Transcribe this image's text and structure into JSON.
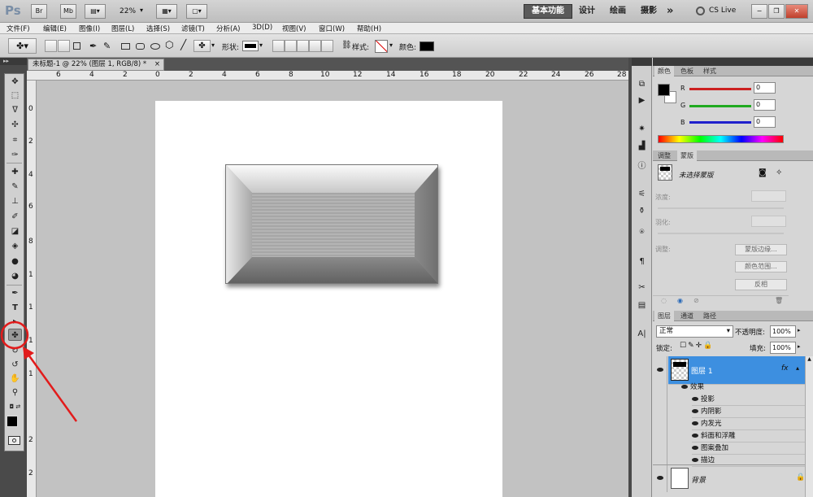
{
  "titlebar": {
    "ps_logo": "Ps",
    "br_btn": "Br",
    "mb_btn": "Mb",
    "zoom": "22%",
    "workspaces": [
      "基本功能",
      "设计",
      "绘画",
      "摄影"
    ],
    "more": "»",
    "cs_live": "CS Live"
  },
  "menu": [
    "文件(F)",
    "编辑(E)",
    "图像(I)",
    "图层(L)",
    "选择(S)",
    "滤镜(T)",
    "分析(A)",
    "3D(D)",
    "视图(V)",
    "窗口(W)",
    "帮助(H)"
  ],
  "options": {
    "shape_label": "形状:",
    "style_label": "样式:",
    "color_label": "颜色:",
    "color_value": "#000000"
  },
  "document": {
    "tab_title": "未标题-1 @ 22% (图层 1, RGB/8) *",
    "close": "×"
  },
  "rulers": {
    "top": [
      "6",
      "4",
      "2",
      "0",
      "2",
      "4",
      "6",
      "8",
      "10",
      "12",
      "14",
      "16",
      "18",
      "20",
      "22",
      "24",
      "26",
      "28"
    ],
    "left": [
      "0",
      "2",
      "4",
      "6",
      "8",
      "1",
      "1",
      "1",
      "1",
      "2",
      "2"
    ]
  },
  "color_panel": {
    "tabs": [
      "颜色",
      "色板",
      "样式"
    ],
    "channels": [
      {
        "label": "R",
        "value": "0",
        "color": "#cc2020"
      },
      {
        "label": "G",
        "value": "0",
        "color": "#20aa20"
      },
      {
        "label": "B",
        "value": "0",
        "color": "#2020cc"
      }
    ]
  },
  "masks_panel": {
    "tabs": [
      "调整",
      "蒙版"
    ],
    "title": "未选择蒙版",
    "density": "浓度:",
    "feather": "羽化:",
    "refine": "调整:",
    "buttons": [
      "蒙版边缘...",
      "颜色范围...",
      "反相"
    ]
  },
  "layers_panel": {
    "tabs": [
      "图层",
      "通道",
      "路径"
    ],
    "blend_mode": "正常",
    "opacity_label": "不透明度:",
    "opacity_value": "100%",
    "lock_label": "锁定:",
    "fill_label": "填充:",
    "fill_value": "100%",
    "layer1": "图层 1",
    "fx": "fx",
    "effects_label": "效果",
    "effects": [
      "投影",
      "内阴影",
      "内发光",
      "斜面和浮雕",
      "图案叠加",
      "描边"
    ],
    "background": "背景"
  }
}
